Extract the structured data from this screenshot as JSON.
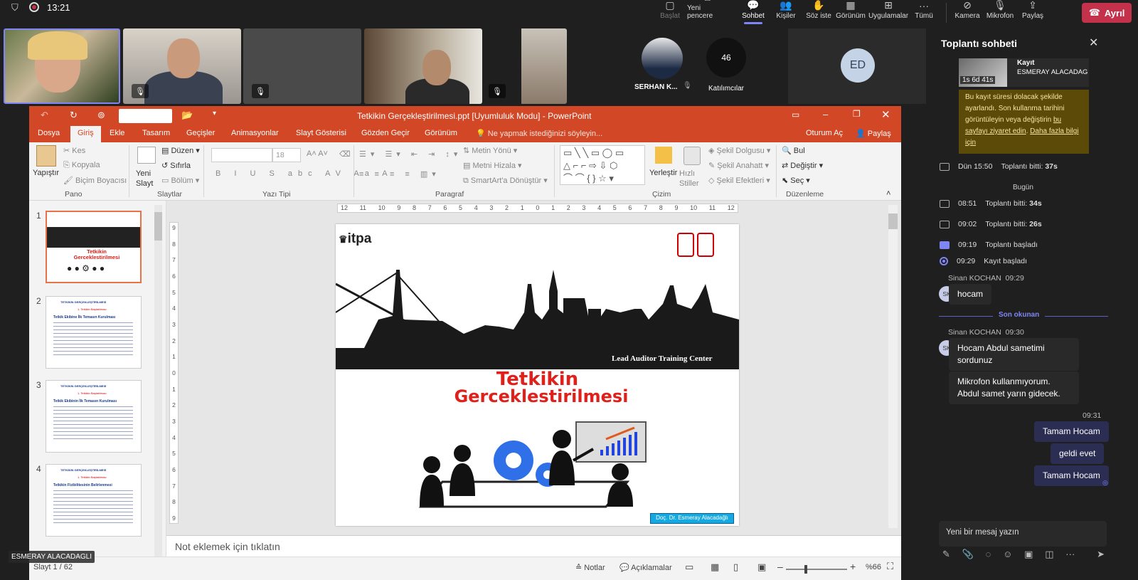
{
  "topbar": {
    "time": "13:21",
    "buttons": [
      {
        "label": "Başlat",
        "icon": "start-icon",
        "state": "disabled"
      },
      {
        "label": "Yeni pencere",
        "icon": "new-window-icon"
      },
      {
        "label": "Sohbet",
        "icon": "chat-icon",
        "state": "active"
      },
      {
        "label": "Kişiler",
        "icon": "people-icon"
      },
      {
        "label": "Söz iste",
        "icon": "raise-hand-icon"
      },
      {
        "label": "Görünüm",
        "icon": "view-icon"
      },
      {
        "label": "Uygulamalar",
        "icon": "apps-icon"
      },
      {
        "label": "Tümü",
        "icon": "more-icon"
      },
      {
        "label": "Kamera",
        "icon": "camera-icon",
        "state": "off"
      },
      {
        "label": "Mikrofon",
        "icon": "mic-icon",
        "state": "off"
      },
      {
        "label": "Paylaş",
        "icon": "share-icon"
      }
    ],
    "leave_label": "Ayrıl"
  },
  "participants": {
    "tiles": [
      {
        "name": "ESMERAY ALACADAGLI",
        "muted": false,
        "speaking": true
      },
      {
        "muted": true
      },
      {
        "muted": true
      },
      {
        "muted": true
      },
      {
        "muted": true
      }
    ],
    "avatar_name": "SERHAN K...",
    "count": "46",
    "count_label": "Katılımcılar",
    "initials": "ED",
    "presenter_label": "ESMERAY ALACADAGLI"
  },
  "ppt": {
    "title": "Tetkikin Gerçekleştirilmesi.ppt [Uyumluluk Modu] - PowerPoint",
    "tabs": [
      "Dosya",
      "Giriş",
      "Ekle",
      "Tasarım",
      "Geçişler",
      "Animasyonlar",
      "Slayt Gösterisi",
      "Gözden Geçir",
      "Görünüm"
    ],
    "tell_me": "Ne yapmak istediğinizi söyleyin...",
    "sign_in": "Oturum Aç",
    "share": "Paylaş",
    "ribbon": {
      "paste": "Yapıştır",
      "cut": "Kes",
      "copy": "Kopyala",
      "format_painter": "Biçim Boyacısı",
      "clipboard": "Pano",
      "new_slide": "Yeni Slayt",
      "layout": "Düzen",
      "reset": "Sıfırla",
      "section": "Bölüm",
      "slides": "Slaytlar",
      "font_size": "18",
      "font": "Yazı Tipi",
      "text_direction": "Metin Yönü",
      "align_text": "Metni Hizala",
      "smartart": "SmartArt'a Dönüştür",
      "paragraph": "Paragraf",
      "arrange": "Yerleştir",
      "quick_styles": "Hızlı Stiller",
      "shape_fill": "Şekil Dolgusu",
      "shape_outline": "Şekil Anahatt",
      "shape_effects": "Şekil Efektleri",
      "drawing": "Çizim",
      "find": "Bul",
      "replace": "Değiştir",
      "select": "Seç",
      "editing": "Düzenleme"
    },
    "ruler_h": [
      "12",
      "11",
      "10",
      "9",
      "8",
      "7",
      "6",
      "5",
      "4",
      "3",
      "2",
      "1",
      "0",
      "1",
      "2",
      "3",
      "4",
      "5",
      "6",
      "7",
      "8",
      "9",
      "10",
      "11",
      "12"
    ],
    "ruler_v": [
      "9",
      "8",
      "7",
      "6",
      "5",
      "4",
      "3",
      "2",
      "1",
      "0",
      "1",
      "2",
      "3",
      "4",
      "5",
      "6",
      "7",
      "8",
      "9"
    ],
    "thumbs": [
      "1",
      "2",
      "3",
      "4"
    ],
    "thumb1_title": "Tetkikin Gerceklestirilmesi",
    "thumb_header": "TETKİKİN GERÇEKLEŞTİRİLMESİ",
    "thumb_subheads": [
      "1. Tetkikin Başlatılması",
      "1. Tetkikin Başlatılması",
      "1. Tetkikin Başlatılması"
    ],
    "thumb_titles": [
      "Tetkik Ekibine İlk Temasın Kurulması",
      "Tetkik Ekibinin İlk Temasın Kurulması",
      "Tetkikin Fizibilitesinin Belirlenmesi"
    ],
    "slide": {
      "logo": "itpa",
      "center_label": "Lead Auditor Training Center",
      "title_line1": "Tetkikin",
      "title_line2": "Gerceklestirilmesi",
      "author": "Doç. Dr. Esmeray Alacadağlı"
    },
    "notes_placeholder": "Not eklemek için tıklatın",
    "status": {
      "slide": "Slayt 1 / 62",
      "notes": "Notlar",
      "comments": "Açıklamalar",
      "zoom": "%66"
    }
  },
  "chat": {
    "title": "Toplantı sohbeti",
    "recording": {
      "label": "Kayıt",
      "owner": "ESMERAY ALACADAGLI",
      "remaining": "1s 6d 41s"
    },
    "notice": {
      "text": "Bu kayıt süresi dolacak şekilde ayarlandı. Son kullanma tarihini görüntüleyin veya değiştirin",
      "link1": "bu sayfayı ziyaret edin",
      "link2": "Daha fazla bilgi için"
    },
    "system_rows": [
      {
        "time": "Dün 15:50",
        "text": "Toplantı bitti:",
        "bold": "37s"
      },
      {
        "time": "08:51",
        "text": "Toplantı bitti:",
        "bold": "34s"
      },
      {
        "time": "09:02",
        "text": "Toplantı bitti:",
        "bold": "26s"
      },
      {
        "time": "09:19",
        "text": "Toplantı başladı",
        "bold": ""
      },
      {
        "time": "09:29",
        "text": "Kayıt başladı",
        "bold": ""
      }
    ],
    "today": "Bugün",
    "messages": [
      {
        "author": "Sinan KOCHAN",
        "time": "09:29",
        "initials": "SK",
        "bubbles": [
          "hocam"
        ]
      },
      {
        "author": "Sinan KOCHAN",
        "time": "09:30",
        "initials": "SK",
        "bubbles": [
          "Hocam Abdul sametimi sordunuz",
          "Mikrofon kullanmıyorum. Abdul samet yarın gidecek."
        ]
      }
    ],
    "last_read": "Son okunan",
    "my_time": "09:31",
    "my_messages": [
      "Tamam Hocam",
      "geldi evet",
      "Tamam Hocam"
    ],
    "compose_placeholder": "Yeni bir mesaj yazın",
    "compose_icons": [
      "format-icon",
      "attach-icon",
      "loop-icon",
      "emoji-icon",
      "gif-icon",
      "sticker-icon",
      "more-icon",
      "send-icon"
    ]
  },
  "colors": {
    "ppt_accent": "#d24726",
    "teams_accent": "#7f85f5",
    "leave_red": "#c4314b",
    "slide_title_red": "#e0201b",
    "notice_bg": "#5c4a08"
  }
}
